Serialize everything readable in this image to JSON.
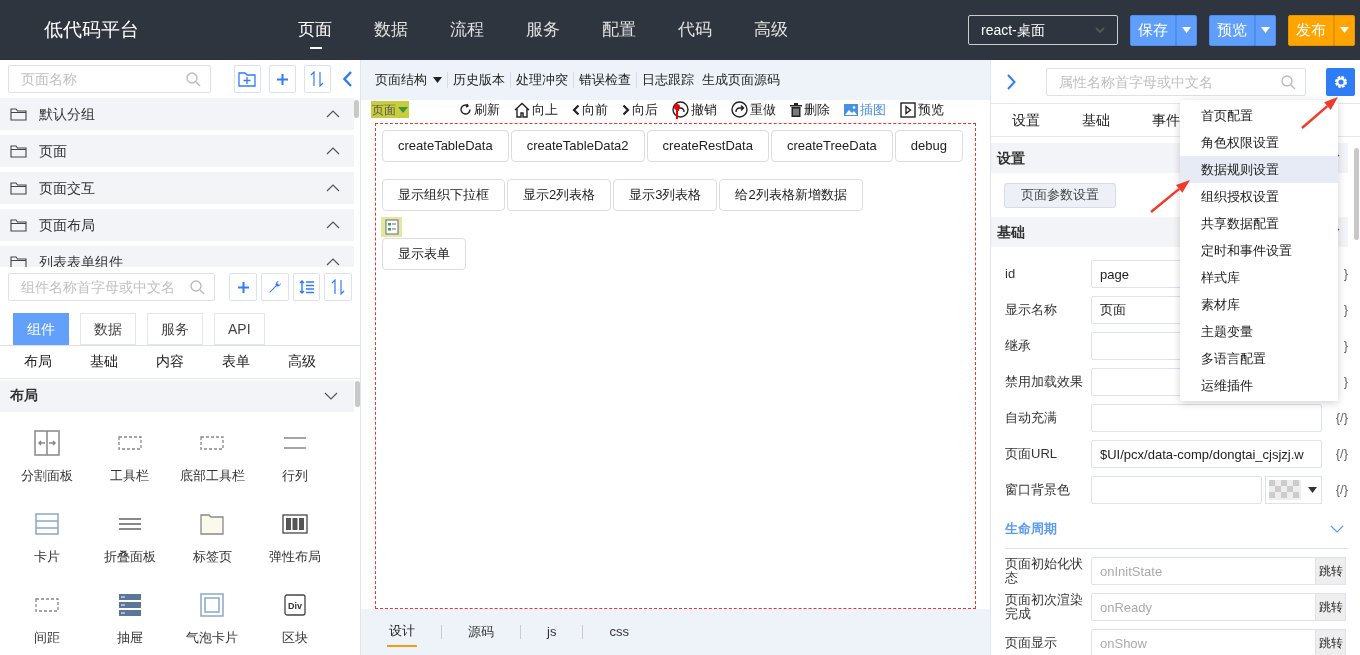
{
  "app": {
    "title": "低代码平台"
  },
  "nav": [
    {
      "label": "页面",
      "selected": true
    },
    {
      "label": "数据",
      "selected": false
    },
    {
      "label": "流程",
      "selected": false
    },
    {
      "label": "服务",
      "selected": false
    },
    {
      "label": "配置",
      "selected": false
    },
    {
      "label": "代码",
      "selected": false
    },
    {
      "label": "高级",
      "selected": false
    }
  ],
  "header_controls": {
    "platform_select": "react-桌面",
    "buttons": [
      {
        "label": "保存",
        "kind": "blue"
      },
      {
        "label": "预览",
        "kind": "blue"
      },
      {
        "label": "发布",
        "kind": "orange"
      }
    ]
  },
  "left_panel": {
    "page_search": {
      "placeholder": "页面名称"
    },
    "groups": [
      {
        "label": "默认分组"
      },
      {
        "label": "页面"
      },
      {
        "label": "页面交互"
      },
      {
        "label": "页面布局"
      },
      {
        "label": "列表表单组件"
      }
    ],
    "component_search": {
      "placeholder": "组件名称首字母或中文名"
    },
    "component_tabs": [
      {
        "label": "组件",
        "selected": true
      },
      {
        "label": "数据",
        "selected": false
      },
      {
        "label": "服务",
        "selected": false
      },
      {
        "label": "API",
        "selected": false
      }
    ],
    "categories": [
      "布局",
      "基础",
      "内容",
      "表单",
      "高级"
    ],
    "section": {
      "title": "布局",
      "expanded": true
    },
    "components": [
      {
        "label": "分割面板",
        "kind": "split"
      },
      {
        "label": "工具栏",
        "kind": "dashed"
      },
      {
        "label": "底部工具栏",
        "kind": "dashed"
      },
      {
        "label": "行列",
        "kind": "lines2"
      },
      {
        "label": "卡片",
        "kind": "card"
      },
      {
        "label": "折叠面板",
        "kind": "lines3"
      },
      {
        "label": "标签页",
        "kind": "folder"
      },
      {
        "label": "弹性布局",
        "kind": "columns"
      },
      {
        "label": "间距",
        "kind": "dashed"
      },
      {
        "label": "抽屉",
        "kind": "drawer"
      },
      {
        "label": "气泡卡片",
        "kind": "bubble"
      },
      {
        "label": "区块",
        "kind": "div",
        "icon_text": "Div"
      }
    ]
  },
  "center": {
    "toolbar": [
      {
        "label": "页面结构",
        "kind": "dropdown"
      },
      {
        "label": "历史版本",
        "kind": "plain"
      },
      {
        "label": "处理冲突",
        "kind": "plain"
      },
      {
        "label": "错误检查",
        "kind": "plain"
      },
      {
        "label": "日志跟踪",
        "kind": "plain"
      },
      {
        "label": "生成页面源码",
        "kind": "plain"
      }
    ],
    "canvas_toolbar": {
      "selector": "页面",
      "actions": [
        {
          "label": "刷新",
          "kind": "refresh",
          "highlighted": false
        },
        {
          "label": "向上",
          "kind": "home",
          "highlighted": false
        },
        {
          "label": "向前",
          "kind": "prev",
          "highlighted": false
        },
        {
          "label": "向后",
          "kind": "next",
          "highlighted": false
        },
        {
          "label": "撤销",
          "kind": "undo",
          "highlighted": false
        },
        {
          "label": "重做",
          "kind": "redo",
          "highlighted": false
        },
        {
          "label": "删除",
          "kind": "trash",
          "highlighted": false
        },
        {
          "label": "插图",
          "kind": "image",
          "highlighted": true
        },
        {
          "label": "预览",
          "kind": "play",
          "highlighted": false
        }
      ]
    },
    "canvas": {
      "button_rows": [
        [
          "createTableData",
          "createTableData2",
          "createRestData",
          "createTreeData",
          "debug"
        ],
        [
          "显示组织下拉框",
          "显示2列表格",
          "显示3列表格",
          "给2列表格新增数据"
        ],
        [
          "显示表单"
        ]
      ]
    },
    "bottom_tabs": [
      {
        "label": "设计",
        "selected": true
      },
      {
        "label": "源码",
        "selected": false
      },
      {
        "label": "js",
        "selected": false
      },
      {
        "label": "css",
        "selected": false
      }
    ]
  },
  "right_panel": {
    "search": {
      "placeholder": "属性名称首字母或中文名"
    },
    "tabs": [
      "设置",
      "基础",
      "事件"
    ],
    "settings_section": {
      "title": "设置",
      "button": "页面参数设置"
    },
    "basic_section": {
      "title": "基础",
      "fields": [
        {
          "label": "id",
          "value": "page",
          "suffix": "}",
          "kind": "text"
        },
        {
          "label": "显示名称",
          "value": "页面",
          "suffix": "}",
          "kind": "text"
        },
        {
          "label": "继承",
          "suffix": "}",
          "kind": "text"
        },
        {
          "label": "禁用加载效果",
          "suffix": "}",
          "kind": "text"
        },
        {
          "label": "自动充满",
          "suffix": "{/}",
          "kind": "text"
        },
        {
          "label": "页面URL",
          "value": "$UI/pcx/data-comp/dongtai_cjsjzj.w",
          "suffix": "{/}",
          "kind": "text"
        },
        {
          "label": "窗口背景色",
          "suffix": "{/}",
          "kind": "color"
        }
      ]
    },
    "lifecycle": {
      "title": "生命周期",
      "events": [
        {
          "label": "页面初始化状态",
          "placeholder": "onInitState",
          "button": "跳转"
        },
        {
          "label": "页面初次渲染完成",
          "placeholder": "onReady",
          "button": "跳转"
        },
        {
          "label": "页面显示",
          "placeholder": "onShow",
          "button": "跳转"
        }
      ]
    },
    "settings_menu": {
      "items": [
        {
          "label": "首页配置",
          "selected": false
        },
        {
          "label": "角色权限设置",
          "selected": false
        },
        {
          "label": "数据规则设置",
          "selected": true
        },
        {
          "label": "组织授权设置",
          "selected": false
        },
        {
          "label": "共享数据配置",
          "selected": false
        },
        {
          "label": "定时和事件设置",
          "selected": false
        },
        {
          "label": "样式库",
          "selected": false
        },
        {
          "label": "素材库",
          "selected": false
        },
        {
          "label": "主题变量",
          "selected": false
        },
        {
          "label": "多语言配置",
          "selected": false
        },
        {
          "label": "运维插件",
          "selected": false
        }
      ]
    }
  }
}
